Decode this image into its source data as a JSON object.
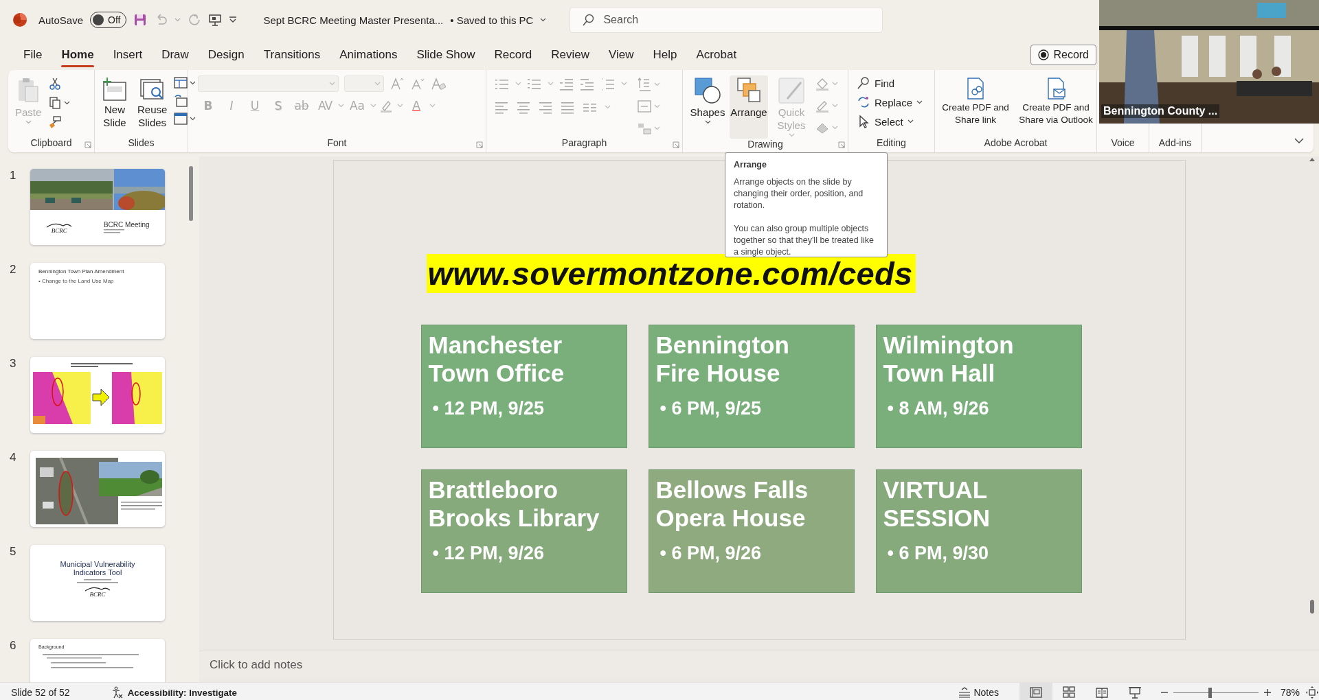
{
  "app": {
    "autosave_label": "AutoSave",
    "autosave": {
      "on": false,
      "label": "Off"
    },
    "document_title": "Sept BCRC Meeting Master Presenta...",
    "save_status": "• Saved to this PC",
    "search": {
      "placeholder": "Search"
    }
  },
  "tabs": [
    {
      "label": "File",
      "selected": false
    },
    {
      "label": "Home",
      "selected": true
    },
    {
      "label": "Insert",
      "selected": false
    },
    {
      "label": "Draw",
      "selected": false
    },
    {
      "label": "Design",
      "selected": false
    },
    {
      "label": "Transitions",
      "selected": false
    },
    {
      "label": "Animations",
      "selected": false
    },
    {
      "label": "Slide Show",
      "selected": false
    },
    {
      "label": "Record",
      "selected": false
    },
    {
      "label": "Review",
      "selected": false
    },
    {
      "label": "View",
      "selected": false
    },
    {
      "label": "Help",
      "selected": false
    },
    {
      "label": "Acrobat",
      "selected": false
    }
  ],
  "record_button": "Record",
  "ribbon": {
    "clipboard": {
      "label": "Clipboard",
      "paste": {
        "label": "Paste",
        "disabled": true
      }
    },
    "slides": {
      "label": "Slides",
      "buttons": [
        "New Slide",
        "Reuse Slides"
      ]
    },
    "font": {
      "label": "Font",
      "disabled": true,
      "buttons": [
        "B",
        "I",
        "U",
        "S",
        "ab",
        "AV",
        "Aa",
        "A"
      ]
    },
    "paragraph": {
      "label": "Paragraph"
    },
    "drawing": {
      "label": "Drawing",
      "buttons": [
        {
          "label": "Shapes",
          "disabled": false,
          "hovered": false
        },
        {
          "label": "Arrange",
          "disabled": false,
          "hovered": true
        },
        {
          "label": "Quick Styles",
          "disabled": true,
          "hovered": false
        }
      ]
    },
    "editing": {
      "label": "Editing",
      "buttons": [
        "Find",
        "Replace",
        "Select"
      ]
    },
    "acrobat": {
      "label": "Adobe Acrobat",
      "buttons": [
        "Create PDF and Share link",
        "Create PDF and Share via Outlook"
      ]
    },
    "voice": {
      "label": "Voice"
    },
    "addins": {
      "label": "Add-ins"
    }
  },
  "video": {
    "label": "Bennington County ..."
  },
  "thumbnails": [
    {
      "number": "1",
      "kind": "photo_title",
      "title": "BCRC Meeting",
      "logo": "BCRC"
    },
    {
      "number": "2",
      "kind": "text",
      "title": "Bennington Town Plan Amendment",
      "bullets": [
        "• Change to the Land Use Map"
      ]
    },
    {
      "number": "3",
      "kind": "map_compare"
    },
    {
      "number": "4",
      "kind": "aerial"
    },
    {
      "number": "5",
      "kind": "title",
      "title": "Municipal Vulnerability Indicators Tool",
      "logo": "BCRC"
    },
    {
      "number": "6",
      "kind": "text",
      "title": "Background"
    }
  ],
  "slide": {
    "url": "www.sovermontzone.com/ceds",
    "cards": [
      {
        "title_lines": [
          "Manchester",
          "Town Office"
        ],
        "detail": "• 12 PM, 9/25",
        "color": "#7aaf7c"
      },
      {
        "title_lines": [
          "Bennington",
          "Fire House"
        ],
        "detail": "• 6 PM, 9/25",
        "color": "#7aaf7c"
      },
      {
        "title_lines": [
          "Wilmington",
          "Town Hall"
        ],
        "detail": "• 8 AM, 9/26",
        "color": "#7aaf7c"
      },
      {
        "title_lines": [
          "Brattleboro",
          "Brooks Library"
        ],
        "detail": "• 12 PM, 9/26",
        "color": "#86aa7b"
      },
      {
        "title_lines": [
          "Bellows Falls",
          "Opera House"
        ],
        "detail": "• 6 PM, 9/26",
        "color": "#8eaa7e"
      },
      {
        "title_lines": [
          "VIRTUAL",
          "SESSION"
        ],
        "detail": "• 6 PM, 9/30",
        "color": "#86aa7b"
      }
    ]
  },
  "notes_placeholder": "Click to add notes",
  "tooltip": {
    "title": "Arrange",
    "paragraphs": [
      "Arrange objects on the slide by changing their order, position, and rotation.",
      "You can also group multiple objects together so that they'll be treated like a single object."
    ]
  },
  "status_bar": {
    "slide": "Slide 52 of 52",
    "accessibility": "Accessibility: Investigate",
    "notes": "Notes",
    "views": [
      {
        "selected": true
      },
      {
        "selected": false
      },
      {
        "selected": false
      },
      {
        "selected": false
      }
    ],
    "zoom": {
      "level": 0.43,
      "label": "78%"
    }
  }
}
